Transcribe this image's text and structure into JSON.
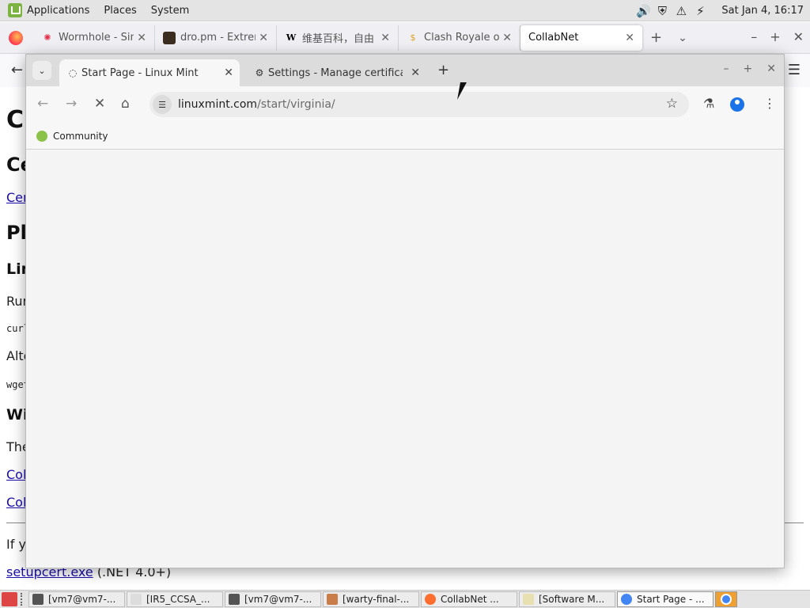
{
  "panel": {
    "menus": [
      "Applications",
      "Places",
      "System"
    ],
    "clock": "Sat Jan  4, 16:17"
  },
  "firefox": {
    "tabs": [
      {
        "title": "Wormhole - Simp",
        "icon": "wormhole-icon"
      },
      {
        "title": "dro.pm - Extrem",
        "icon": "dropm-icon"
      },
      {
        "title": "维基百科，自由",
        "icon": "wikipedia-icon"
      },
      {
        "title": "Clash Royale on",
        "icon": "coin-icon"
      },
      {
        "title": "CollabNet",
        "icon": ""
      }
    ],
    "page": {
      "h1": "C",
      "h2a": "Ce",
      "link1": "Cer",
      "h2b": "Pl",
      "h3a": "Lin",
      "p1": "Run",
      "code1": "curl",
      "p2": "Alte",
      "code2": "wget",
      "h3b": "Wi",
      "p3": "The",
      "link2": "Col",
      "link3": "Col",
      "p4": "If y",
      "exe_link": "setupcert.exe",
      "exe_note": "(.NET 4.0+)"
    }
  },
  "chrome": {
    "tabs": [
      {
        "title": "Start Page - Linux Mint",
        "active": true
      },
      {
        "title": "Settings - Manage certificate",
        "active": false
      }
    ],
    "url_host": "linuxmint.com",
    "url_path": "/start/virginia/",
    "bookmarks": [
      "Community"
    ]
  },
  "taskbar": {
    "items": [
      {
        "label": "[vm7@vm7-...",
        "color": "#555555"
      },
      {
        "label": "[IR5_CCSA_...",
        "color": "#dddddd"
      },
      {
        "label": "[vm7@vm7-...",
        "color": "#555555"
      },
      {
        "label": "[warty-final-...",
        "color": "#c97d4a"
      },
      {
        "label": "CollabNet ...",
        "color": "#ff6d2f"
      },
      {
        "label": "[Software M...",
        "color": "#e8e0b0"
      },
      {
        "label": "Start Page - ...",
        "color": "#4285f4"
      }
    ]
  },
  "colors": {
    "link": "#1a0dab",
    "mint_green": "#7cb342",
    "chrome_blue": "#1a73e8"
  }
}
